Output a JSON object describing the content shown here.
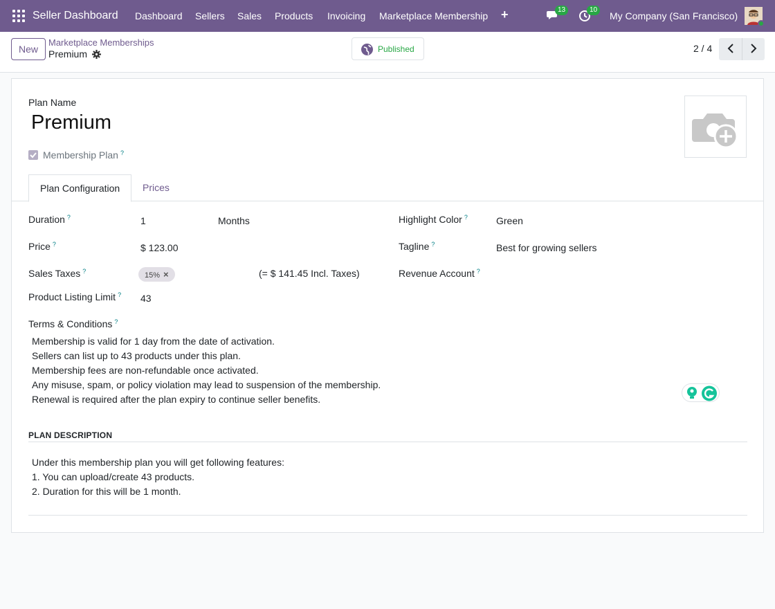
{
  "navbar": {
    "brand": "Seller Dashboard",
    "menu": [
      "Dashboard",
      "Sellers",
      "Sales",
      "Products",
      "Invoicing",
      "Marketplace Membership"
    ],
    "chat_count": "13",
    "activity_count": "10",
    "company": "My Company (San Francisco)",
    "accent": "#6f5b8e"
  },
  "control": {
    "new_label": "New",
    "breadcrumb": "Marketplace Memberships",
    "record": "Premium",
    "status": "Published",
    "pager": "2 / 4"
  },
  "form": {
    "plan_name_label": "Plan Name",
    "plan_name": "Premium",
    "membership_plan_label": "Membership Plan",
    "membership_plan_checked": true,
    "tabs": [
      "Plan Configuration",
      "Prices"
    ],
    "duration_label": "Duration",
    "duration_value": "1",
    "duration_unit": "Months",
    "price_label": "Price",
    "price_value": "$ 123.00",
    "sales_taxes_label": "Sales Taxes",
    "tax_tag": "15%",
    "tax_incl": "(= $ 141.45 Incl. Taxes)",
    "listing_limit_label": "Product Listing Limit",
    "listing_limit_value": "43",
    "highlight_color_label": "Highlight Color",
    "highlight_color_value": "Green",
    "tagline_label": "Tagline",
    "tagline_value": "Best for growing sellers",
    "revenue_account_label": "Revenue Account",
    "terms_label": "Terms & Conditions",
    "terms": [
      "Membership is valid for 1 day from the date of activation.",
      "Sellers can list up to 43 products under this plan.",
      "Membership fees are non-refundable once activated.",
      "Any misuse, spam, or policy violation may lead to suspension of the membership.",
      "Renewal is required after the plan expiry to continue seller benefits."
    ],
    "description_title": "PLAN DESCRIPTION",
    "description": [
      "Under this membership plan you will get following features:",
      "1. You can upload/create 43 products.",
      "2. Duration for this will be 1 month."
    ],
    "tooltip_mark": "?"
  }
}
